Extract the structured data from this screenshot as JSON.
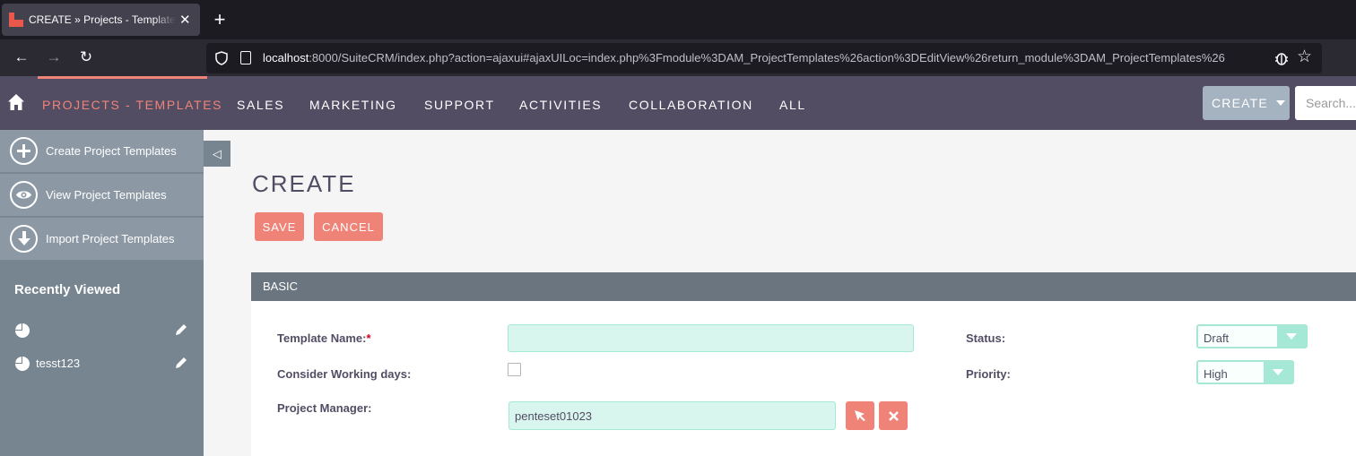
{
  "browser": {
    "tab_title": "CREATE » Projects - Templates » SuiteCRM",
    "tab_close": "✕",
    "new_tab": "+",
    "url_host": "localhost",
    "url_rest": ":8000/SuiteCRM/index.php?action=ajaxui#ajaxUILoc=index.php%3Fmodule%3DAM_ProjectTemplates%26action%3DEditView%26return_module%3DAM_ProjectTemplates%26",
    "back": "←",
    "forward": "→",
    "reload": "↻",
    "bookmark": "☆"
  },
  "topnav": {
    "items": [
      "PROJECTS - TEMPLATES",
      "SALES",
      "MARKETING",
      "SUPPORT",
      "ACTIVITIES",
      "COLLABORATION",
      "ALL"
    ],
    "create_label": "CREATE",
    "search_placeholder": "Search..."
  },
  "sidebar": {
    "actions": [
      {
        "label": "Create Project Templates",
        "icon": "plus-icon"
      },
      {
        "label": "View Project Templates",
        "icon": "eye-icon"
      },
      {
        "label": "Import Project Templates",
        "icon": "download-icon"
      }
    ],
    "recent_title": "Recently Viewed",
    "recent": [
      {
        "name": ""
      },
      {
        "name": "tesst123"
      }
    ],
    "collapse": "◁"
  },
  "main": {
    "title": "CREATE",
    "save_label": "SAVE",
    "cancel_label": "CANCEL",
    "panel_title": "BASIC",
    "fields": {
      "template_name_label": "Template Name:",
      "required_mark": "*",
      "template_name_value": "",
      "working_days_label": "Consider Working days:",
      "working_days_checked": false,
      "project_manager_label": "Project Manager:",
      "project_manager_value": "penteset01023",
      "status_label": "Status:",
      "status_value": "Draft",
      "priority_label": "Priority:",
      "priority_value": "High"
    }
  },
  "colors": {
    "nav_bg": "#534d64",
    "accent": "#f08377",
    "sidebar_bg": "#778591",
    "input_bg": "#d8f5ee"
  }
}
